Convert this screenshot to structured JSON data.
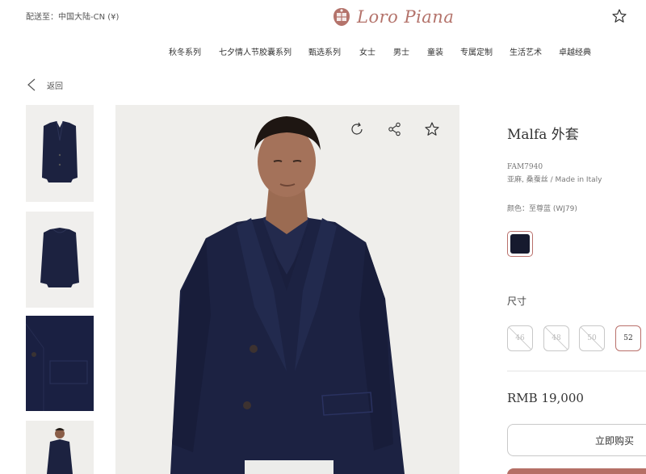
{
  "header": {
    "ship_to": "配送至：中国大陆-CN (¥)",
    "logo_text": "Loro Piana",
    "wishlist_icon": "star-outline-icon"
  },
  "nav": {
    "items": [
      "秋冬系列",
      "七夕情人节胶囊系列",
      "甄选系列",
      "女士",
      "男士",
      "童装",
      "专属定制",
      "生活艺术",
      "卓越经典"
    ]
  },
  "back": {
    "label": "返回",
    "icon": "chevron-left-icon"
  },
  "gallery": {
    "thumbnails": [
      "jacket-front-flat",
      "jacket-back-flat",
      "fabric-detail",
      "model-full-body"
    ],
    "hero_tools": [
      "rotate-360-icon",
      "share-icon",
      "star-outline-icon"
    ]
  },
  "product": {
    "title": "Malfa 外套",
    "code": "FAM7940",
    "material": "亚麻, 桑蚕丝 / Made in Italy",
    "color_label": "颜色：至尊蓝 (WJ79)",
    "color_hex": "#161a2e",
    "size_label": "尺寸",
    "sizes": [
      {
        "value": "46",
        "available": false
      },
      {
        "value": "48",
        "available": false
      },
      {
        "value": "50",
        "available": false
      },
      {
        "value": "52",
        "available": true,
        "selected": true
      }
    ],
    "price": "RMB 19,000",
    "buy_label": "立即购买"
  },
  "colors": {
    "accent": "#b9706b",
    "navy": "#1a2140"
  }
}
